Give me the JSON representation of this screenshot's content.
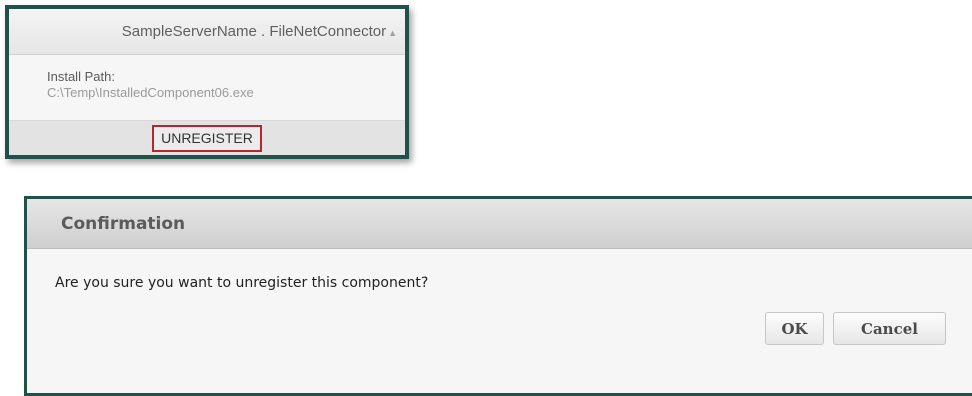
{
  "component_card": {
    "title": "SampleServerName . FileNetConnector",
    "collapse_icon": "▲",
    "install_path_label": "Install Path:",
    "install_path_value": "C:\\Temp\\InstalledComponent06.exe",
    "unregister_label": "UNREGISTER"
  },
  "confirmation_dialog": {
    "title": "Confirmation",
    "message": "Are you sure you want to unregister this component?",
    "ok_label": "OK",
    "cancel_label": "Cancel"
  },
  "colors": {
    "frame_border": "#21524a",
    "highlight_border": "#b2262d"
  }
}
